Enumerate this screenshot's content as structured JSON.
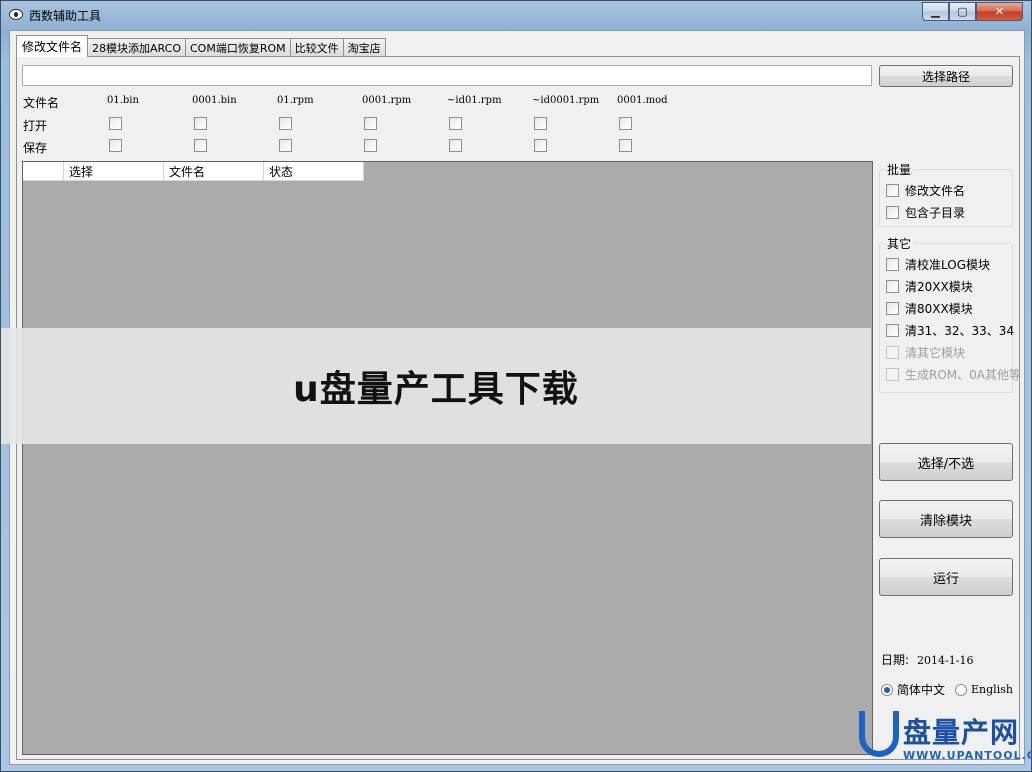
{
  "window": {
    "title": "西数辅助工具"
  },
  "tabs": [
    "修改文件名",
    "28模块添加ARCO",
    "COM端口恢复ROM",
    "比较文件",
    "淘宝店"
  ],
  "toolbar": {
    "path_value": "",
    "select_path_label": "选择路径"
  },
  "file_row": {
    "label": "文件名",
    "files": [
      "01.bin",
      "0001.bin",
      "01.rpm",
      "0001.rpm",
      "~id01.rpm",
      "~id0001.rpm",
      "0001.mod"
    ]
  },
  "open_row": {
    "label": "打开"
  },
  "save_row": {
    "label": "保存"
  },
  "grid": {
    "columns": [
      "选择",
      "文件名",
      "状态"
    ]
  },
  "batch_group": {
    "title": "批量",
    "options": [
      "修改文件名",
      "包含子目录"
    ]
  },
  "other_group": {
    "title": "其它",
    "options": [
      "清校准LOG模块",
      "清20XX模块",
      "清80XX模块",
      "清31、32、33、34",
      "清其它模块",
      "生成ROM、0A其他等"
    ]
  },
  "actions": {
    "select_toggle": "选择/不选",
    "clear_modules": "清除模块",
    "run": "运行"
  },
  "footer": {
    "date_label": "日期:",
    "date_value": "2014-1-16",
    "lang_zh": "简体中文",
    "lang_en": "English"
  },
  "overlay": {
    "caption": "u盘量产工具下载"
  },
  "watermark": {
    "brand": "盘量产网",
    "url": "WWW.UPANTOOL.COM"
  },
  "colors": {
    "grid_bg": "#ababab",
    "accent": "#1b63c6"
  }
}
